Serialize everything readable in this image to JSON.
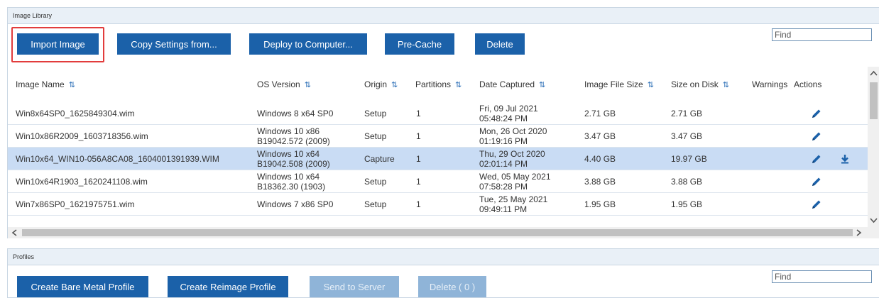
{
  "image_library": {
    "title": "Image Library",
    "buttons": {
      "import": "Import Image",
      "copy_settings": "Copy Settings from...",
      "deploy": "Deploy to Computer...",
      "precache": "Pre-Cache",
      "delete": "Delete"
    },
    "find": "Find",
    "columns": {
      "image_name": "Image Name",
      "os_version": "OS Version",
      "origin": "Origin",
      "partitions": "Partitions",
      "date_captured": "Date Captured",
      "image_file_size": "Image File Size",
      "size_on_disk": "Size on Disk",
      "warnings": "Warnings",
      "actions": "Actions"
    },
    "sort_glyph": "⇅",
    "rows": [
      {
        "name": "Win8x64SP0_1625849304.wim",
        "os1": "Windows 8 x64 SP0",
        "os2": "",
        "origin": "Setup",
        "partitions": "1",
        "date1": "Fri, 09 Jul 2021",
        "date2": "05:48:24 PM",
        "file_size": "2.71 GB",
        "disk_size": "2.71 GB",
        "selected": false
      },
      {
        "name": "Win10x86R2009_1603718356.wim",
        "os1": "Windows 10 x86",
        "os2": "B19042.572 (2009)",
        "origin": "Setup",
        "partitions": "1",
        "date1": "Mon, 26 Oct 2020",
        "date2": "01:19:16 PM",
        "file_size": "3.47 GB",
        "disk_size": "3.47 GB",
        "selected": false
      },
      {
        "name": "Win10x64_WIN10-056A8CA08_1604001391939.WIM",
        "os1": "Windows 10 x64",
        "os2": "B19042.508 (2009)",
        "origin": "Capture",
        "partitions": "1",
        "date1": "Thu, 29 Oct 2020",
        "date2": "02:01:14 PM",
        "file_size": "4.40 GB",
        "disk_size": "19.97 GB",
        "selected": true
      },
      {
        "name": "Win10x64R1903_1620241108.wim",
        "os1": "Windows 10 x64",
        "os2": "B18362.30 (1903)",
        "origin": "Setup",
        "partitions": "1",
        "date1": "Wed, 05 May 2021",
        "date2": "07:58:28 PM",
        "file_size": "3.88 GB",
        "disk_size": "3.88 GB",
        "selected": false
      },
      {
        "name": "Win7x86SP0_1621975751.wim",
        "os1": "Windows 7 x86 SP0",
        "os2": "",
        "origin": "Setup",
        "partitions": "1",
        "date1": "Tue, 25 May 2021",
        "date2": "09:49:11 PM",
        "file_size": "1.95 GB",
        "disk_size": "1.95 GB",
        "selected": false
      }
    ],
    "icons": {
      "edit": "pencil-icon",
      "download": "download-icon"
    },
    "accent": "#1b61a9",
    "highlight_color": "#e23c3c"
  },
  "profiles": {
    "title": "Profiles",
    "buttons": {
      "bare_metal": "Create Bare Metal Profile",
      "reimage": "Create Reimage Profile",
      "send": "Send to Server",
      "delete": "Delete ( 0 )"
    },
    "find": "Find"
  }
}
